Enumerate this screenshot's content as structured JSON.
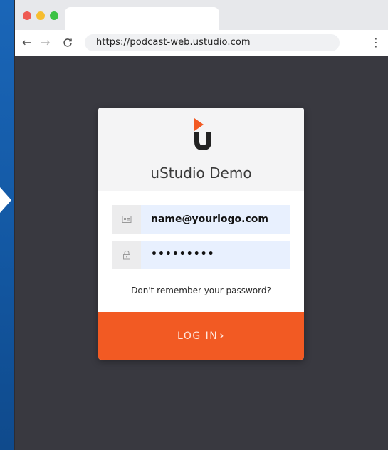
{
  "browser": {
    "url": "https://podcast-web.ustudio.com",
    "icons": {
      "back": "arrow-left-icon",
      "forward": "arrow-right-icon",
      "reload": "reload-icon",
      "menu": "kebab-menu-icon"
    }
  },
  "login": {
    "title": "uStudio Demo",
    "email_value": "name@yourlogo.com",
    "password_value": "•••••••••",
    "forgot_text": "Don't remember your password?",
    "login_label": "LOG IN",
    "login_chevron": "›"
  },
  "colors": {
    "accent": "#f25a23",
    "background": "#393940",
    "input_fill": "#e8f0fe"
  }
}
